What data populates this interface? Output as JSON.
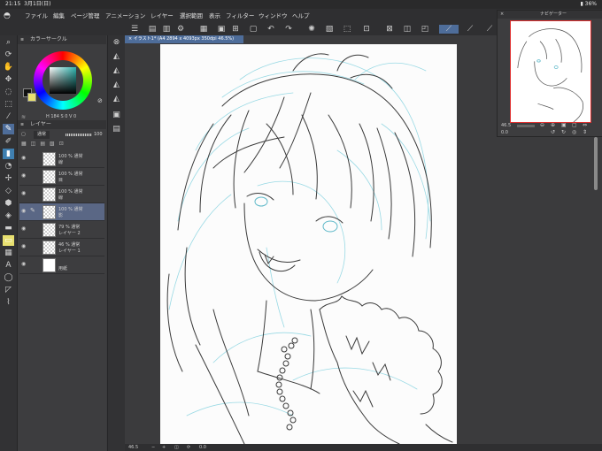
{
  "status": {
    "time": "21:15",
    "date": "3月1日(日)",
    "battery": "36%"
  },
  "menu": [
    "ファイル",
    "編集",
    "ページ管理",
    "アニメーション",
    "レイヤー",
    "選択範囲",
    "表示",
    "フィルター",
    "ウィンドウ",
    "ヘルプ"
  ],
  "color_panel": {
    "title": "カラーサークル",
    "hsv_readout": "H 184  S 0  V 0"
  },
  "layer_panel": {
    "title": "レイヤー",
    "blend_mode": "通常",
    "opacity": "100",
    "layers": [
      {
        "opacity": "100 % 通常",
        "name": "線",
        "selected": false
      },
      {
        "opacity": "100 % 通常",
        "name": "目",
        "selected": false
      },
      {
        "opacity": "100 % 通常",
        "name": "線",
        "selected": false
      },
      {
        "opacity": "100 % 通常",
        "name": "影",
        "selected": true
      },
      {
        "opacity": "79 % 通常",
        "name": "レイヤー 2",
        "selected": false
      },
      {
        "opacity": "46 % 通常",
        "name": "レイヤー 1",
        "selected": false
      },
      {
        "opacity": "",
        "name": "用紙",
        "selected": false
      }
    ]
  },
  "document": {
    "tab_title": "イラスト1* (A4 2894 x 4093px 350dpi 46.5%)"
  },
  "canvas_status": {
    "zoom": "46.5",
    "angle": "0.0"
  },
  "navigator": {
    "title": "ナビゲーター",
    "zoom": "46.5",
    "angle": "0.0"
  },
  "colors": {
    "accent": "#4e6d9a",
    "lineart_blue": "#7fd3e0",
    "lineart_dark": "#333333"
  }
}
